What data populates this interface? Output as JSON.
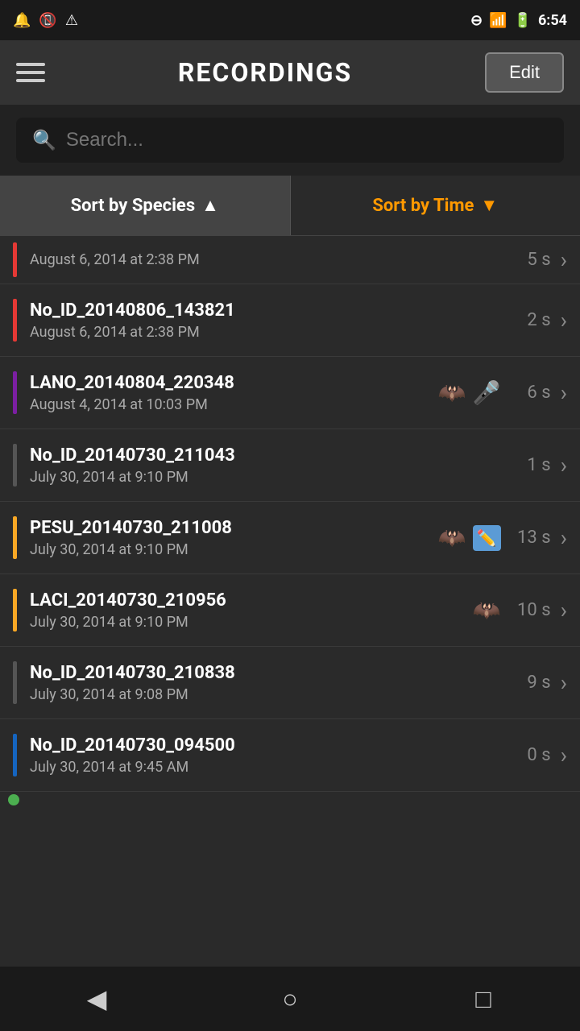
{
  "statusBar": {
    "time": "6:54",
    "icons": [
      "notification",
      "phone-off",
      "battery"
    ]
  },
  "header": {
    "title": "RECORDINGS",
    "editLabel": "Edit",
    "menuIcon": "hamburger-icon"
  },
  "search": {
    "placeholder": "Search..."
  },
  "sortButtons": [
    {
      "id": "sort-species",
      "label": "Sort by Species",
      "arrow": "▲",
      "active": true
    },
    {
      "id": "sort-time",
      "label": "Sort by Time",
      "arrow": "▼",
      "active": false
    }
  ],
  "partialItem": {
    "title": "",
    "date": "August 6, 2014 at 2:38 PM",
    "duration": "5 s",
    "barColor": "#e53935"
  },
  "recordings": [
    {
      "id": "rec1",
      "title": "No_ID_20140806_143821",
      "date": "August 6, 2014 at 2:38 PM",
      "duration": "2 s",
      "barColor": "#e53935",
      "icons": []
    },
    {
      "id": "rec2",
      "title": "LANO_20140804_220348",
      "date": "August 4, 2014 at 10:03 PM",
      "duration": "6 s",
      "barColor": "#7b1fa2",
      "icons": [
        "bat-yellow",
        "mic-green"
      ]
    },
    {
      "id": "rec3",
      "title": "No_ID_20140730_211043",
      "date": "July 30, 2014 at 9:10 PM",
      "duration": "1 s",
      "barColor": "#424242",
      "icons": []
    },
    {
      "id": "rec4",
      "title": "PESU_20140730_211008",
      "date": "July 30, 2014 at 9:10 PM",
      "duration": "13 s",
      "barColor": "#f9a825",
      "icons": [
        "bat-yellow",
        "pen-blue"
      ]
    },
    {
      "id": "rec5",
      "title": "LACI_20140730_210956",
      "date": "July 30, 2014 at 9:10 PM",
      "duration": "10 s",
      "barColor": "#f9a825",
      "icons": [
        "bat-yellow"
      ]
    },
    {
      "id": "rec6",
      "title": "No_ID_20140730_210838",
      "date": "July 30, 2014 at 9:08 PM",
      "duration": "9 s",
      "barColor": "#424242",
      "icons": []
    },
    {
      "id": "rec7",
      "title": "No_ID_20140730_094500",
      "date": "July 30, 2014 at 9:45 AM",
      "duration": "0 s",
      "barColor": "#1565c0",
      "icons": []
    }
  ],
  "bottomNav": {
    "backLabel": "◀",
    "homeLabel": "○",
    "recentLabel": "□"
  }
}
